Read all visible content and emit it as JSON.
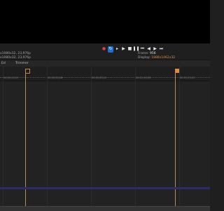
{
  "transport": {
    "record_icon": "record-icon",
    "loop_icon": "loop-icon",
    "play_icon": "play-icon",
    "play_from_start_icon": "play-from-start-icon",
    "stop_icon": "stop-icon",
    "pause_icon": "pause-icon",
    "prev_frame_icon": "prev-frame-icon",
    "rewind_icon": "rewind-icon",
    "fast_forward_icon": "fast-forward-icon",
    "next_frame_icon": "next-frame-icon"
  },
  "info": {
    "project_props": "x1080x32, 23,976p",
    "preview_props": "x1080x32, 23,976p",
    "frame_label": "Frame:",
    "frame_value": "956",
    "display_label": "Display:",
    "display_value": "1888x1062x32"
  },
  "trackhead": {
    "t1": "Ed",
    "t2": "Trimmer"
  },
  "ruler": {
    "ticks": [
      "00:00:49;29",
      "00:00:59;28",
      "00:01:09;29",
      "00:01:19;29",
      "00:01:29;29"
    ]
  },
  "colors": {
    "accent_blue": "#1f6fd1",
    "marker_orange": "#e08a3a",
    "record_red": "#e23d3d"
  }
}
